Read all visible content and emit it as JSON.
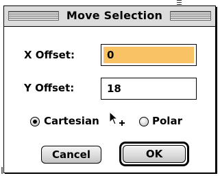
{
  "dialog": {
    "title": "Move Selection"
  },
  "fields": {
    "x_label": "X Offset:",
    "x_value": "0",
    "y_label": "Y Offset:",
    "y_value": "18"
  },
  "coordinate_mode": {
    "options": [
      {
        "label": "Cartesian",
        "selected": true
      },
      {
        "label": "Polar",
        "selected": false
      }
    ]
  },
  "buttons": {
    "cancel_label": "Cancel",
    "ok_label": "OK"
  },
  "colors": {
    "active_field_highlight": "#f9c264",
    "titlebar": "#dcdcdc"
  },
  "icons": {
    "cursor": "arrow-with-plus-cursor"
  }
}
